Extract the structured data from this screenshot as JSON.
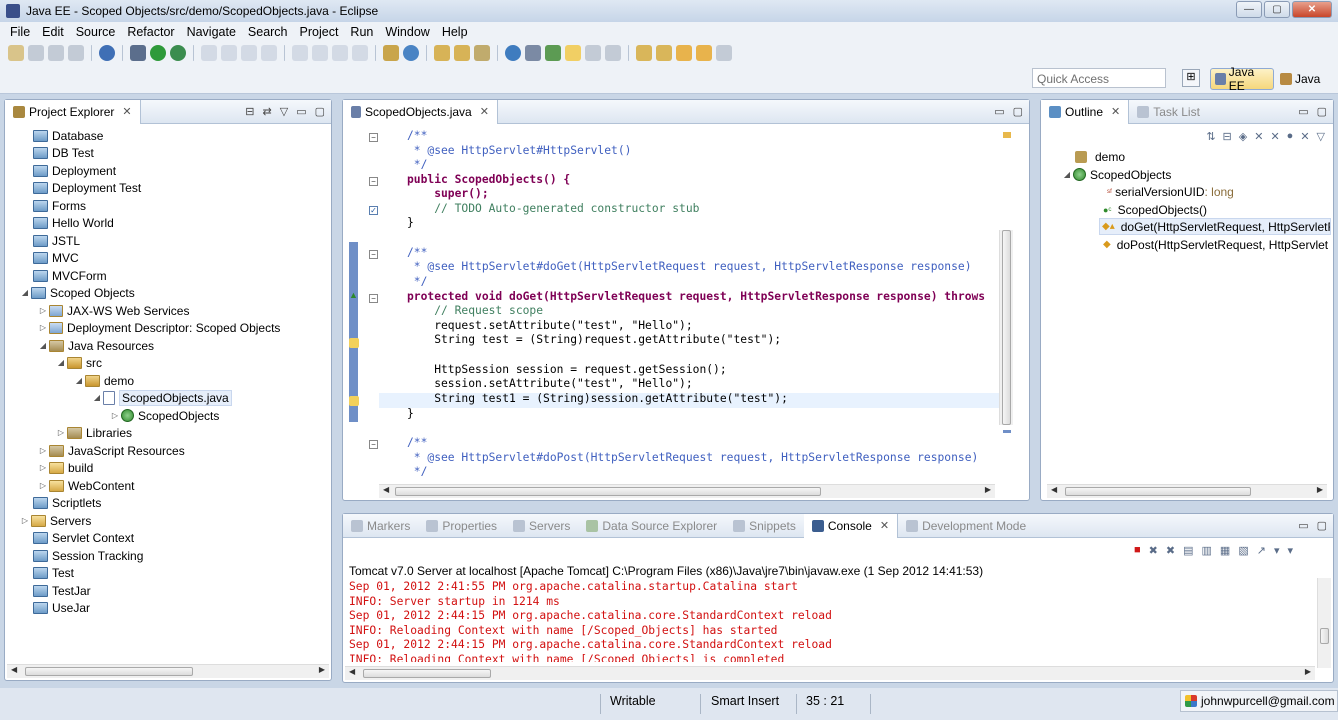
{
  "window": {
    "title": "Java EE - Scoped Objects/src/demo/ScopedObjects.java - Eclipse",
    "controls": [
      "—",
      "▢",
      "✕"
    ]
  },
  "menu": [
    "File",
    "Edit",
    "Source",
    "Refactor",
    "Navigate",
    "Search",
    "Project",
    "Run",
    "Window",
    "Help"
  ],
  "quick_access": {
    "placeholder": "Quick Access"
  },
  "perspectives": {
    "active": "Java EE",
    "other": "Java"
  },
  "project_explorer": {
    "tab": "Project Explorer",
    "items": [
      {
        "label": "Database"
      },
      {
        "label": "DB Test"
      },
      {
        "label": "Deployment"
      },
      {
        "label": "Deployment Test"
      },
      {
        "label": "Forms"
      },
      {
        "label": "Hello World"
      },
      {
        "label": "JSTL"
      },
      {
        "label": "MVC"
      },
      {
        "label": "MVCForm"
      },
      {
        "label": "Scoped Objects"
      },
      {
        "label": "JAX-WS Web Services"
      },
      {
        "label": "Deployment Descriptor: Scoped Objects"
      },
      {
        "label": "Java Resources"
      },
      {
        "label": "src"
      },
      {
        "label": "demo"
      },
      {
        "label": "ScopedObjects.java"
      },
      {
        "label": "ScopedObjects"
      },
      {
        "label": "Libraries"
      },
      {
        "label": "JavaScript Resources"
      },
      {
        "label": "build"
      },
      {
        "label": "WebContent"
      },
      {
        "label": "Scriptlets"
      },
      {
        "label": "Servers"
      },
      {
        "label": "Servlet Context"
      },
      {
        "label": "Session Tracking"
      },
      {
        "label": "Test"
      },
      {
        "label": "TestJar"
      },
      {
        "label": "UseJar"
      }
    ]
  },
  "editor": {
    "tab": "ScopedObjects.java",
    "lines": [
      "/**",
      " * @see HttpServlet#HttpServlet()",
      " */",
      "public ScopedObjects() {",
      "    super();",
      "    // TODO Auto-generated constructor stub",
      "}",
      "",
      "/**",
      " * @see HttpServlet#doGet(HttpServletRequest request, HttpServletResponse response)",
      " */",
      "protected void doGet(HttpServletRequest request, HttpServletResponse response) throws",
      "    // Request scope",
      "    request.setAttribute(\"test\", \"Hello\");",
      "    String test = (String)request.getAttribute(\"test\");",
      "",
      "    HttpSession session = request.getSession();",
      "    session.setAttribute(\"test\", \"Hello\");",
      "    String test1 = (String)session.getAttribute(\"test\");",
      "}",
      "",
      "/**",
      " * @see HttpServlet#doPost(HttpServletRequest request, HttpServletResponse response)",
      " */"
    ]
  },
  "outline": {
    "tab": "Outline",
    "tab2": "Task List",
    "items": [
      {
        "label": "demo"
      },
      {
        "label": "ScopedObjects"
      },
      {
        "label": "serialVersionUID",
        "type": " : long"
      },
      {
        "label": "ScopedObjects()"
      },
      {
        "label": "doGet(HttpServletRequest, HttpServletR"
      },
      {
        "label": "doPost(HttpServletRequest, HttpServlet"
      }
    ]
  },
  "bottom_tabs": [
    "Markers",
    "Properties",
    "Servers",
    "Data Source Explorer",
    "Snippets",
    "Console",
    "Development Mode"
  ],
  "console": {
    "title": "Tomcat v7.0 Server at localhost [Apache Tomcat] C:\\Program Files (x86)\\Java\\jre7\\bin\\javaw.exe (1 Sep 2012 14:41:53)",
    "lines": [
      "Sep 01, 2012 2:41:55 PM org.apache.catalina.startup.Catalina start",
      "INFO: Server startup in 1214 ms",
      "Sep 01, 2012 2:44:15 PM org.apache.catalina.core.StandardContext reload",
      "INFO: Reloading Context with name [/Scoped_Objects] has started",
      "Sep 01, 2012 2:44:15 PM org.apache.catalina.core.StandardContext reload",
      "INFO: Reloading Context with name [/Scoped_Objects] is completed"
    ]
  },
  "status": {
    "writable": "Writable",
    "insert_mode": "Smart Insert",
    "position": "35 : 21",
    "user": "johnwpurcell@gmail.com"
  },
  "colors": {
    "keyword": "#7f0055",
    "comment": "#3f7f5f",
    "javadoc": "#3f5fbf",
    "string": "#2a00ff",
    "console_error": "#d21010"
  }
}
